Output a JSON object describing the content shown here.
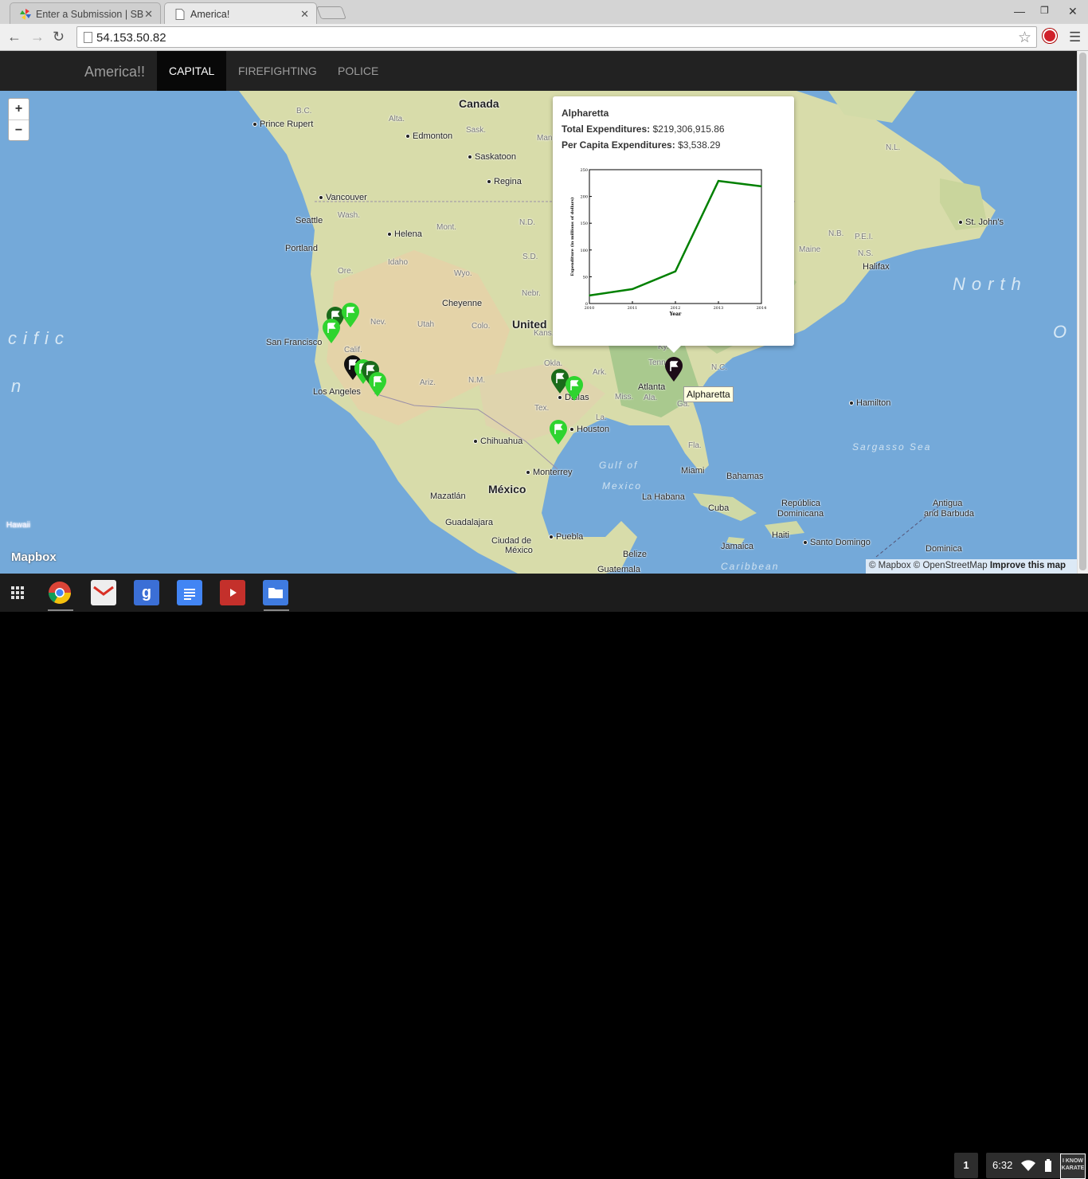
{
  "browser": {
    "tabs": [
      {
        "title": "Enter a Submission | SB"
      },
      {
        "title": "America!"
      }
    ],
    "url": "54.153.50.82"
  },
  "app": {
    "brand": "America!!",
    "nav": [
      "CAPITAL",
      "FIREFIGHTING",
      "POLICE"
    ],
    "active_nav": "CAPITAL"
  },
  "map": {
    "zoom_in": "+",
    "zoom_out": "−",
    "labels": {
      "canada": "Canada",
      "bc": "B.C.",
      "alta": "Alta.",
      "sask": "Sask.",
      "man": "Man.",
      "prince_rupert": "Prince Rupert",
      "edmonton": "Edmonton",
      "saskatoon": "Saskatoon",
      "regina": "Regina",
      "vancouver": "Vancouver",
      "seattle": "Seattle",
      "wash": "Wash.",
      "helena": "Helena",
      "mont": "Mont.",
      "nd": "N.D.",
      "portland": "Portland",
      "idaho": "Idaho",
      "sd": "S.D.",
      "ore": "Ore.",
      "wyo": "Wyo.",
      "cheyenne": "Cheyenne",
      "nebr": "Nebr.",
      "united": "United",
      "nev": "Nev.",
      "utah": "Utah",
      "colo": "Colo.",
      "kans": "Kans.",
      "san_francisco": "San Francisco",
      "calif": "Calif.",
      "los_angeles": "Los Angeles",
      "ariz": "Ariz.",
      "nm": "N.M.",
      "okla": "Okla.",
      "ark": "Ark.",
      "dallas": "Dallas",
      "tex": "Tex.",
      "la": "La.",
      "miss": "Miss.",
      "ala": "Ala.",
      "houston": "Houston",
      "chihuahua": "Chihuahua",
      "monterrey": "Monterrey",
      "mexico": "México",
      "mazatlan": "Mazatlán",
      "guadalajara": "Guadalajara",
      "ciudad_mexico_1": "Ciudad de",
      "ciudad_mexico_2": "México",
      "puebla": "Puebla",
      "belize": "Belize",
      "guatemala": "Guatemala",
      "tenn": "Tenn.",
      "nc": "N.C.",
      "atlanta": "Atlanta",
      "ga": "Ga.",
      "fla": "Fla.",
      "miami": "Miami",
      "bahamas": "Bahamas",
      "la_habana": "La Habana",
      "cuba": "Cuba",
      "jamaica": "Jamaica",
      "haiti": "Haiti",
      "santo_domingo": "Santo Domingo",
      "rep_dom_1": "República",
      "rep_dom_2": "Dominicana",
      "antigua_1": "Antigua",
      "antigua_2": "and Barbuda",
      "dominica": "Dominica",
      "hamilton": "Hamilton",
      "sargasso": "Sargasso Sea",
      "gulf_1": "Gulf of",
      "gulf_2": "Mexico",
      "caribbean": "Caribbean",
      "nl": "N.L.",
      "st_johns": "St. John's",
      "nb": "N.B.",
      "pei": "P.E.I.",
      "ns": "N.S.",
      "halifax": "Halifax",
      "maine": "Maine",
      "north": "North",
      "ocean_o": "O",
      "pacific_1": "cific",
      "pacific_2": "n",
      "hawaii": "Hawaii",
      "ky": "Ky."
    },
    "popup": {
      "title": "Alpharetta",
      "total_label": "Total Expenditures:",
      "total_value": "$219,306,915.86",
      "per_capita_label": "Per Capita Expenditures:",
      "per_capita_value": "$3,538.29"
    },
    "tooltip": "Alpharetta",
    "mapbox_logo": "Mapbox",
    "attribution_prefix": "© Mapbox © OpenStreetMap",
    "attribution_link": "Improve this map"
  },
  "chart_data": {
    "type": "line",
    "x": [
      2010,
      2011,
      2012,
      2013,
      2014
    ],
    "values": [
      15,
      27,
      60,
      229,
      219
    ],
    "xlabel": "Year",
    "ylabel": "Expenditure (in millions of dollars)",
    "xlim": [
      2010,
      2014
    ],
    "ylim": [
      0,
      250
    ],
    "yticks": [
      0,
      50,
      100,
      150,
      200,
      250
    ],
    "xticks": [
      "2010",
      "2011",
      "2012",
      "2013",
      "2014"
    ],
    "line_color": "#008000"
  },
  "shelf": {
    "apps": [
      "apps-launcher",
      "chrome",
      "gmail",
      "google-search",
      "google-docs",
      "youtube",
      "files"
    ],
    "notification_count": "1",
    "time": "6:32",
    "avatar_text": "I KNOW KARATE"
  }
}
